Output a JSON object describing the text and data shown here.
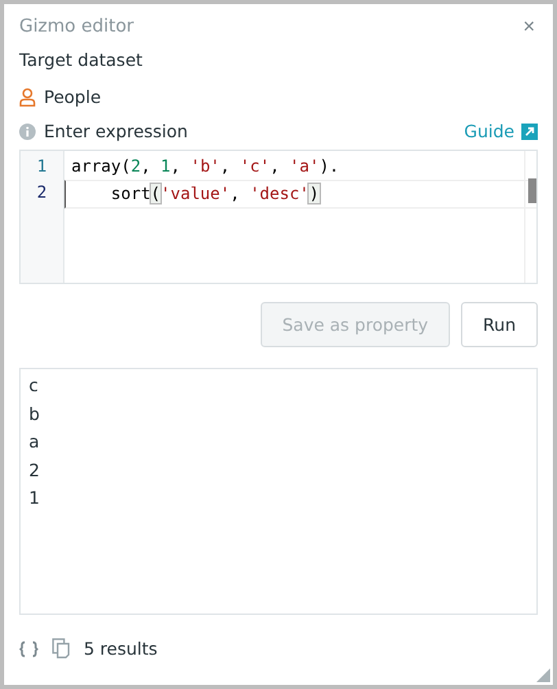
{
  "window": {
    "title": "Gizmo editor",
    "close": "×"
  },
  "target": {
    "label": "Target dataset",
    "dataset": "People"
  },
  "expression": {
    "label": "Enter expression",
    "guide": "Guide"
  },
  "editor": {
    "lines": [
      {
        "number": "1",
        "active": false,
        "tokens": [
          {
            "kind": "plain",
            "text": "array("
          },
          {
            "kind": "number",
            "text": "2"
          },
          {
            "kind": "plain",
            "text": ", "
          },
          {
            "kind": "number",
            "text": "1"
          },
          {
            "kind": "plain",
            "text": ", "
          },
          {
            "kind": "string",
            "text": "'b'"
          },
          {
            "kind": "plain",
            "text": ", "
          },
          {
            "kind": "string",
            "text": "'c'"
          },
          {
            "kind": "plain",
            "text": ", "
          },
          {
            "kind": "string",
            "text": "'a'"
          },
          {
            "kind": "plain",
            "text": ")."
          }
        ]
      },
      {
        "number": "2",
        "active": true,
        "tokens": [
          {
            "kind": "plain",
            "text": "    sort"
          },
          {
            "kind": "bracket",
            "text": "("
          },
          {
            "kind": "string",
            "text": "'value'"
          },
          {
            "kind": "plain",
            "text": ", "
          },
          {
            "kind": "string",
            "text": "'desc'"
          },
          {
            "kind": "bracket",
            "text": ")"
          }
        ]
      }
    ]
  },
  "buttons": [
    {
      "label": "Save as property",
      "disabled": true
    },
    {
      "label": "Run",
      "disabled": false
    }
  ],
  "results": [
    "c",
    "b",
    "a",
    "2",
    "1"
  ],
  "status": {
    "count": "5 results"
  }
}
